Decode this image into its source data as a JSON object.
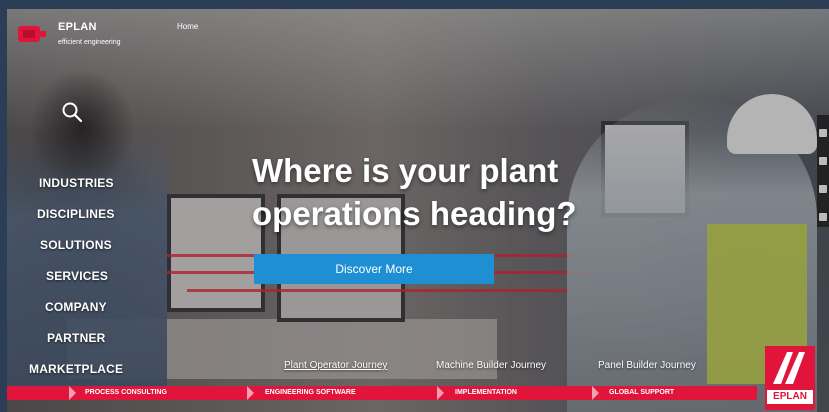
{
  "header": {
    "brand_name": "EPLAN",
    "brand_tagline": "efficient engineering",
    "home_link": "Home"
  },
  "side_nav": {
    "items": [
      {
        "label": "INDUSTRIES"
      },
      {
        "label": "DISCIPLINES"
      },
      {
        "label": "SOLUTIONS"
      },
      {
        "label": "SERVICES"
      },
      {
        "label": "COMPANY"
      },
      {
        "label": "PARTNER"
      },
      {
        "label": "MARKETPLACE"
      }
    ]
  },
  "hero": {
    "title_line1": "Where is your plant",
    "title_line2": "operations heading?",
    "cta_label": "Discover More"
  },
  "journeys": [
    {
      "label": "Plant Operator Journey",
      "active": true
    },
    {
      "label": "Machine Builder Journey",
      "active": false
    },
    {
      "label": "Panel Builder Journey",
      "active": false
    }
  ],
  "ribbon": {
    "items": [
      {
        "label": "PROCESS CONSULTING"
      },
      {
        "label": "ENGINEERING SOFTWARE"
      },
      {
        "label": "IMPLEMENTATION"
      },
      {
        "label": "GLOBAL SUPPORT"
      }
    ]
  },
  "badge": {
    "word": "EPLAN"
  },
  "colors": {
    "brand_red": "#e1143c",
    "cta_blue": "#1f8fd3",
    "text_white": "#ffffff"
  }
}
